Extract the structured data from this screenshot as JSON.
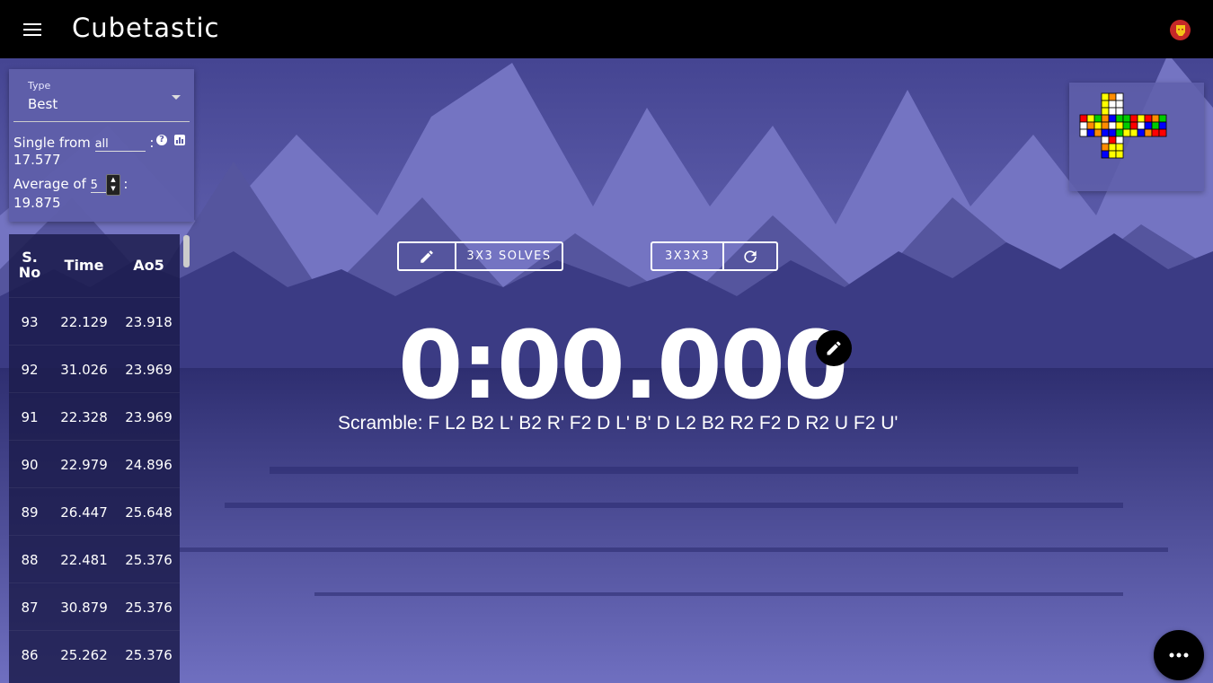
{
  "app": {
    "title": "Cubetastic"
  },
  "stats": {
    "type_label": "Type",
    "type_value": "Best",
    "single_prefix": "Single from",
    "single_range": "all",
    "single_value": "17.577",
    "average_prefix": "Average of",
    "average_n": "5",
    "average_value": "19.875",
    "colon": ":"
  },
  "table": {
    "headers": {
      "sno": "S. No",
      "time": "Time",
      "ao5": "Ao5"
    },
    "rows": [
      {
        "sno": "93",
        "time": "22.129",
        "ao5": "23.918"
      },
      {
        "sno": "92",
        "time": "31.026",
        "ao5": "23.969"
      },
      {
        "sno": "91",
        "time": "22.328",
        "ao5": "23.969"
      },
      {
        "sno": "90",
        "time": "22.979",
        "ao5": "24.896"
      },
      {
        "sno": "89",
        "time": "26.447",
        "ao5": "25.648"
      },
      {
        "sno": "88",
        "time": "22.481",
        "ao5": "25.376"
      },
      {
        "sno": "87",
        "time": "30.879",
        "ao5": "25.376"
      },
      {
        "sno": "86",
        "time": "25.262",
        "ao5": "25.376"
      }
    ]
  },
  "session": {
    "label": "3X3 SOLVES"
  },
  "puzzle": {
    "label": "3X3X3"
  },
  "timer": {
    "display": "0:00.000"
  },
  "scramble": {
    "text": "Scramble: F L2 B2 L' B2 R' F2 D L' B' D L2 B2 R2 F2 D R2 U F2 U'"
  },
  "cube_net": {
    "U": [
      "Y",
      "O",
      "W",
      "Y",
      "W",
      "W",
      "Y",
      "W",
      "W"
    ],
    "L": [
      "R",
      "Y",
      "G",
      "W",
      "O",
      "Y",
      "W",
      "B",
      "O"
    ],
    "F": [
      "O",
      "B",
      "G",
      "O",
      "W",
      "Y",
      "B",
      "B",
      "G"
    ],
    "R": [
      "G",
      "R",
      "Y",
      "G",
      "R",
      "W",
      "Y",
      "Y",
      "B"
    ],
    "B": [
      "R",
      "O",
      "G",
      "B",
      "G",
      "B",
      "O",
      "R",
      "R"
    ],
    "D": [
      "W",
      "R",
      "W",
      "O",
      "Y",
      "Y",
      "B",
      "Y",
      "Y"
    ],
    "colors": {
      "W": "#ffffff",
      "Y": "#ffff00",
      "R": "#ff0000",
      "O": "#ff8c00",
      "G": "#00cc00",
      "B": "#0000ff"
    }
  },
  "icons": {
    "menu": "menu-icon",
    "avatar": "ironman-avatar-icon",
    "edit": "pencil-icon",
    "refresh": "refresh-icon",
    "more": "more-horiz-icon"
  },
  "colors": {
    "appbar": "#000000",
    "accent": "#5a5aa8"
  }
}
